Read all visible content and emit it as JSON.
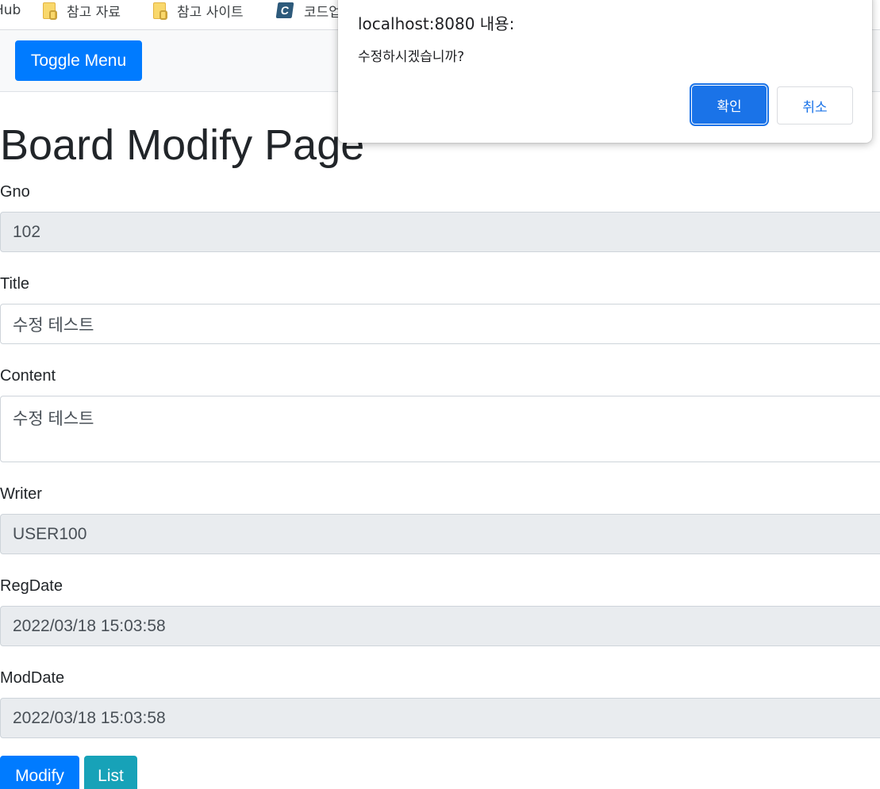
{
  "bookmarks": [
    {
      "label": "Hub",
      "icon": "none"
    },
    {
      "label": "참고 자료",
      "icon": "folder-icon"
    },
    {
      "label": "참고 사이트",
      "icon": "folder-icon"
    },
    {
      "label": "코드업",
      "icon": "codeup-icon"
    }
  ],
  "navbar": {
    "toggle_label": "Toggle Menu"
  },
  "page": {
    "title": "Board Modify Page"
  },
  "form": {
    "gno_label": "Gno",
    "gno_value": "102",
    "title_label": "Title",
    "title_value": "수정 테스트",
    "content_label": "Content",
    "content_value": "수정 테스트",
    "writer_label": "Writer",
    "writer_value": "USER100",
    "regdate_label": "RegDate",
    "regdate_value": "2022/03/18 15:03:58",
    "moddate_label": "ModDate",
    "moddate_value": "2022/03/18 15:03:58",
    "modify_label": "Modify",
    "list_label": "List"
  },
  "dialog": {
    "title": "localhost:8080 내용:",
    "message": "수정하시겠습니까?",
    "ok_label": "확인",
    "cancel_label": "취소"
  },
  "colors": {
    "primary": "#007bff",
    "info": "#17a2b8",
    "dialog_accent": "#1a73e8",
    "readonly_bg": "#e9ecef"
  }
}
